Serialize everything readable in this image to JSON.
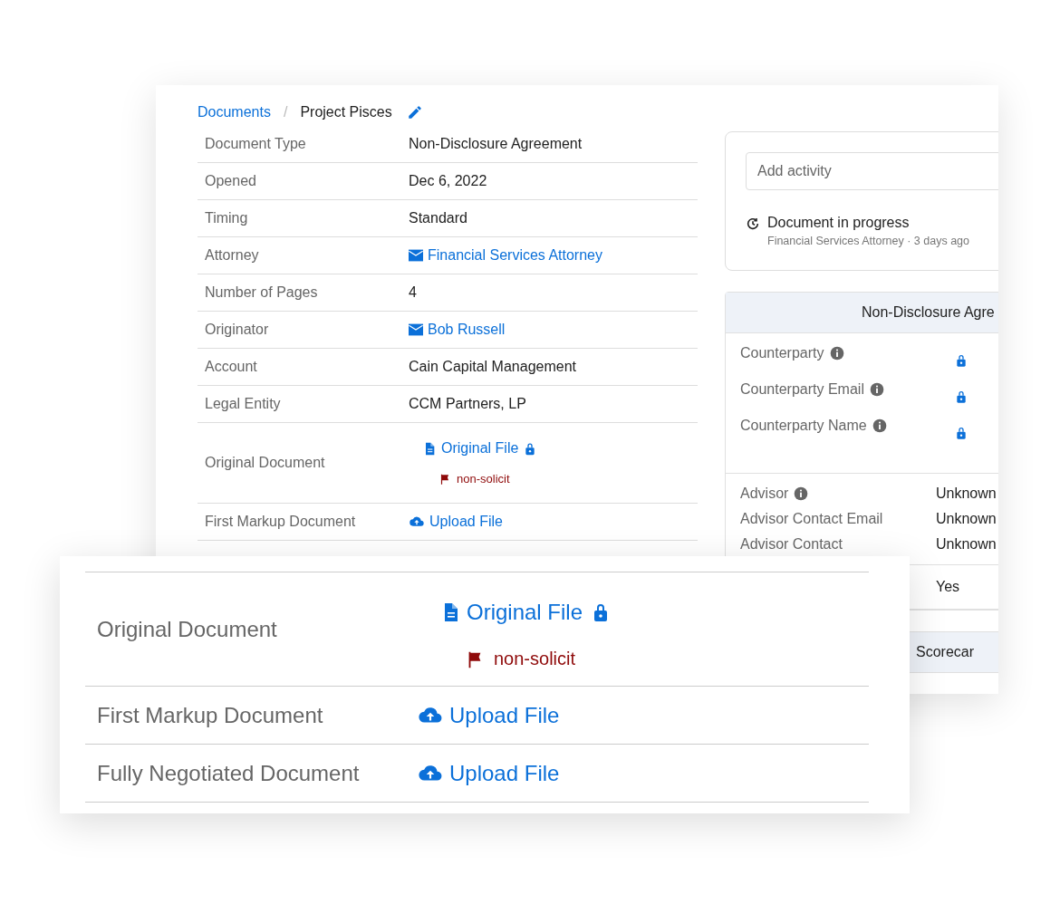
{
  "breadcrumb": {
    "link": "Documents",
    "separator": "/",
    "current": "Project Pisces"
  },
  "details": [
    {
      "label": "Document Type",
      "kind": "text",
      "value": "Non-Disclosure Agreement"
    },
    {
      "label": "Opened",
      "kind": "text",
      "value": "Dec 6, 2022"
    },
    {
      "label": "Timing",
      "kind": "text",
      "value": "Standard"
    },
    {
      "label": "Attorney",
      "kind": "email",
      "value": "Financial Services Attorney"
    },
    {
      "label": "Number of Pages",
      "kind": "text",
      "value": "4"
    },
    {
      "label": "Originator",
      "kind": "email",
      "value": "Bob Russell"
    },
    {
      "label": "Account",
      "kind": "text",
      "value": "Cain Capital Management"
    },
    {
      "label": "Legal Entity",
      "kind": "text",
      "value": "CCM Partners, LP"
    },
    {
      "label": "Original Document",
      "kind": "file",
      "value": "Original File",
      "locked": true,
      "flag": "non-solicit"
    },
    {
      "label": "First Markup Document",
      "kind": "upload",
      "value": "Upload File"
    }
  ],
  "activity": {
    "placeholder": "Add activity",
    "entries": [
      {
        "title": "Document in progress",
        "meta": "Financial Services Attorney · 3 days ago"
      }
    ]
  },
  "nda_panel": {
    "title": "Non-Disclosure Agre",
    "locked_fields": [
      {
        "label": "Counterparty",
        "info": true,
        "locked": true
      },
      {
        "label": "Counterparty Email",
        "info": true,
        "locked": true
      },
      {
        "label": "Counterparty Name",
        "info": true,
        "locked": true
      }
    ],
    "fields": [
      {
        "label": "Advisor",
        "info": true,
        "value": "Unknown"
      },
      {
        "label": "Advisor Contact Email",
        "info": false,
        "value": "Unknown"
      },
      {
        "label": "Advisor Contact",
        "info": false,
        "value": "Unknown"
      }
    ],
    "partly_hidden_rows": [
      {
        "value": "Yes"
      }
    ]
  },
  "scorecard": {
    "title": "Scorecar"
  },
  "zoom": {
    "rows": [
      {
        "label": "Original Document",
        "kind": "file",
        "value": "Original File",
        "locked": true,
        "flag": "non-solicit"
      },
      {
        "label": "First Markup Document",
        "kind": "upload",
        "value": "Upload File"
      },
      {
        "label": "Fully Negotiated Document",
        "kind": "upload",
        "value": "Upload File"
      }
    ]
  }
}
